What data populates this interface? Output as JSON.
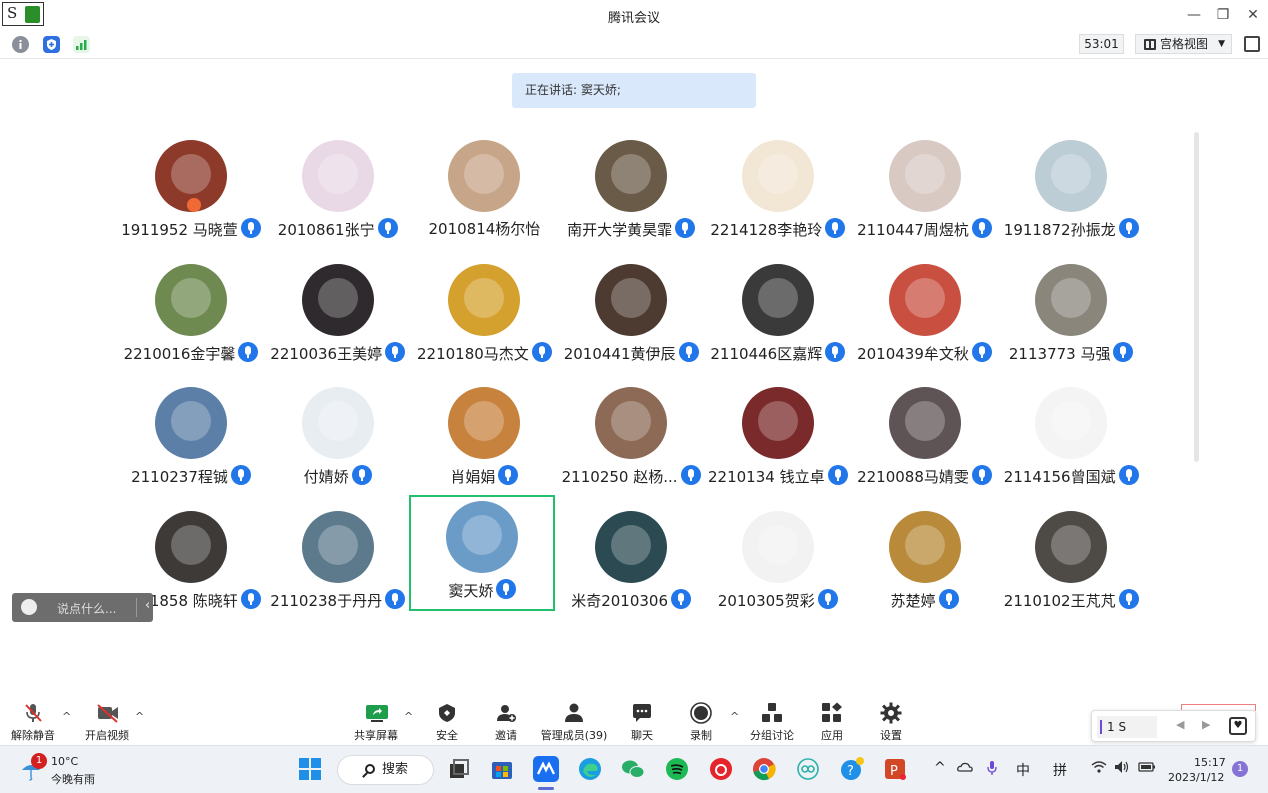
{
  "window": {
    "title": "腾讯会议",
    "minimize": "—",
    "restore": "❐",
    "close": "✕"
  },
  "app_logo": {
    "letter": "S"
  },
  "toolbar": {
    "timer": "53:01",
    "view_label": "宫格视图",
    "view_caret": "▼"
  },
  "speaker": {
    "text": "正在讲话: 窦天娇;"
  },
  "participants": [
    {
      "name": "1911952 马晓萱",
      "mic": true,
      "color": "#8d3a2b"
    },
    {
      "name": "2010861张宁",
      "mic": true,
      "color": "#e9d9e6"
    },
    {
      "name": "2010814杨尔怡",
      "mic": false,
      "color": "#c7a588"
    },
    {
      "name": "南开大学黄昊霏",
      "mic": true,
      "color": "#6a5a48"
    },
    {
      "name": "2214128李艳玲",
      "mic": true,
      "color": "#f2e6d4"
    },
    {
      "name": "2110447周煜杭",
      "mic": true,
      "color": "#d9c9c3"
    },
    {
      "name": "1911872孙振龙",
      "mic": true,
      "color": "#bccdd6"
    },
    {
      "name": "2210016金宇馨",
      "mic": true,
      "color": "#6f8a50"
    },
    {
      "name": "2210036王美婷",
      "mic": true,
      "color": "#2e2a2d"
    },
    {
      "name": "2210180马杰文",
      "mic": true,
      "color": "#d5a12e"
    },
    {
      "name": "2010441黄伊辰",
      "mic": true,
      "color": "#4d3b31"
    },
    {
      "name": "2110446区嘉辉",
      "mic": true,
      "color": "#3a3a3a"
    },
    {
      "name": "2010439牟文秋",
      "mic": true,
      "color": "#c95040"
    },
    {
      "name": "2113773 马强",
      "mic": true,
      "color": "#8a867c"
    },
    {
      "name": "2110237程铖",
      "mic": true,
      "color": "#5b7fa6"
    },
    {
      "name": "付婧娇",
      "mic": true,
      "color": "#e8edf2"
    },
    {
      "name": "肖娟娟",
      "mic": true,
      "color": "#c7823e"
    },
    {
      "name": "2110250   赵杨...",
      "mic": true,
      "color": "#8c6a55"
    },
    {
      "name": "2210134 钱立卓",
      "mic": true,
      "color": "#7a2a2a"
    },
    {
      "name": "2210088马婧雯",
      "mic": true,
      "color": "#5f5455"
    },
    {
      "name": "2114156曾国斌",
      "mic": true,
      "color": "#f4f4f4"
    },
    {
      "name": "1911858  陈晓轩",
      "mic": true,
      "color": "#3d3a38"
    },
    {
      "name": "2110238于丹丹",
      "mic": true,
      "color": "#5c7a8c"
    },
    {
      "name": "窦天娇",
      "mic": true,
      "color": "#6b9cc8",
      "active": true
    },
    {
      "name": "米奇2010306",
      "mic": true,
      "color": "#2b4a52"
    },
    {
      "name": "2010305贺彩",
      "mic": true,
      "color": "#f2f2f2"
    },
    {
      "name": "苏楚婷",
      "mic": true,
      "color": "#b88a3a"
    },
    {
      "name": "2110102王芃芃",
      "mic": true,
      "color": "#4e4a46"
    }
  ],
  "chat": {
    "placeholder": "说点什么...",
    "collapse": "‹"
  },
  "controls": {
    "mute": "解除静音",
    "video": "开启视频",
    "share": "共享屏幕",
    "security": "安全",
    "invite": "邀请",
    "members": "管理成员(39)",
    "chat": "聊天",
    "record": "录制",
    "breakout": "分组讨论",
    "apps": "应用",
    "settings": "设置",
    "caret": "^"
  },
  "ime_widget": {
    "value": "1 S",
    "prev": "◀",
    "next": "▶",
    "fav": "♥"
  },
  "taskbar": {
    "weather_temp": "10°C",
    "weather_desc": "今晚有雨",
    "weather_badge": "1",
    "search_label": "搜索",
    "tray_caret": "^",
    "lang": "中",
    "ime": "拼",
    "time": "15:17",
    "date": "2023/1/12",
    "notif_badge": "1"
  }
}
